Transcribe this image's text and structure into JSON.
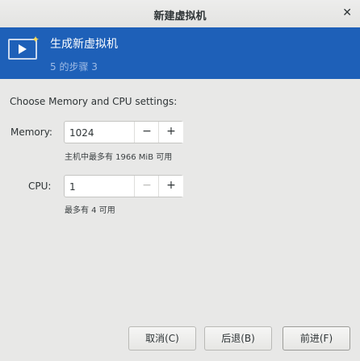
{
  "window": {
    "title": "新建虚拟机"
  },
  "banner": {
    "title": "生成新虚拟机",
    "step": "5 的步骤 3"
  },
  "page": {
    "heading": "Choose Memory and CPU settings:"
  },
  "memory": {
    "label": "Memory:",
    "value": "1024",
    "hint": "主机中最多有 1966 MiB 可用"
  },
  "cpu": {
    "label": "CPU:",
    "value": "1",
    "hint": "最多有 4 可用"
  },
  "footer": {
    "cancel": "取消(C)",
    "back": "后退(B)",
    "forward": "前进(F)"
  }
}
